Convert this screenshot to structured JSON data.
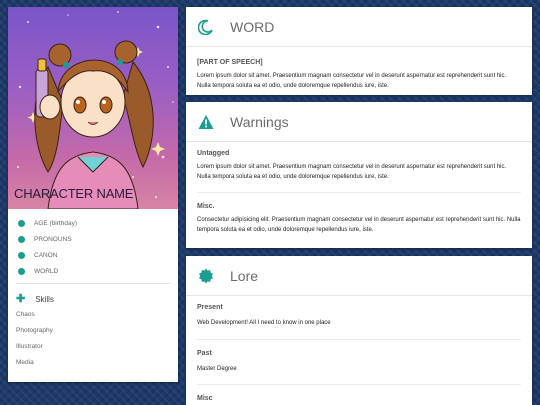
{
  "character": {
    "name": "CHARACTER NAME",
    "info": [
      "AGE (birthday)",
      "PRONOUNS",
      "CANON",
      "WORLD"
    ],
    "skills_title": "Skills",
    "skills": [
      "Chaos",
      "Photography",
      "Illustrator",
      "Media"
    ]
  },
  "word_card": {
    "title": "WORD",
    "part_of_speech": "[PART OF SPEECH]",
    "definition": "Lorem ipsum dolor sit amet. Praesentium magnam consectetur vel in deserunt aspernatur est reprehenderit sunt hic. Nulla tempora soluta ea et odio, unde doloremque repellendus iure, iste."
  },
  "warnings_card": {
    "title": "Warnings",
    "sections": [
      {
        "label": "Untagged",
        "text": "Lorem ipsum dolor sit amet. Praesentium magnam consectetur vel in deserunt aspernatur est reprehenderit sunt hic. Nulla tempora soluta ea et odio, unde doloremque repellendus iure, iste."
      },
      {
        "label": "Misc.",
        "text": "Consectetur adipisicing elit. Praesentium magnam consectetur vel in deserunt aspernatur est reprehenderit sunt hic. Nulla tempora soluta ea et odio, unde doloremque repellendus iure, iste."
      }
    ]
  },
  "lore_card": {
    "title": "Lore",
    "sections": [
      {
        "label": "Present",
        "text": "Web Development! All I need to know in one place"
      },
      {
        "label": "Past",
        "text": "Master Degree"
      },
      {
        "label": "Misc",
        "text": ""
      }
    ]
  },
  "colors": {
    "accent": "#1a9e8f",
    "background": "#1d3a6b"
  },
  "icons": {
    "word": "moon-icon",
    "warnings": "warning-icon",
    "lore": "badge-icon",
    "skills": "plus-icon",
    "info": "dot-icon"
  }
}
